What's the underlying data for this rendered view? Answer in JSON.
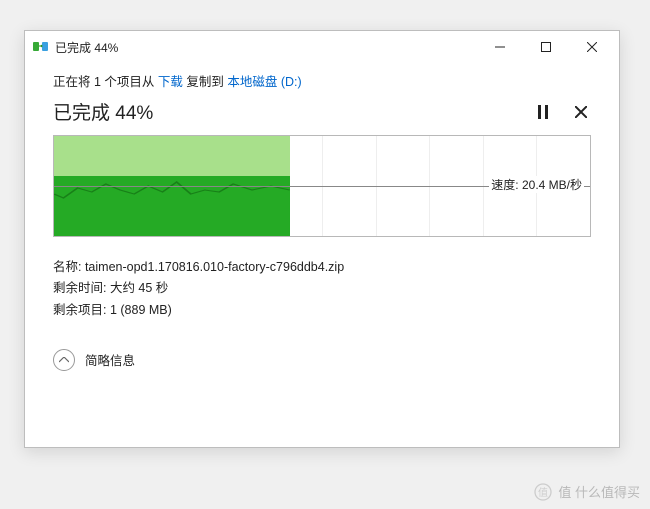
{
  "titlebar": {
    "title": "已完成 44%"
  },
  "copy_line": {
    "prefix": "正在将 1 个项目从 ",
    "source": "下载",
    "mid": " 复制到 ",
    "dest": "本地磁盘 (D:)"
  },
  "progress": {
    "label": "已完成 44%",
    "percent": 44
  },
  "speed": {
    "label": "速度: ",
    "value": "20.4 MB/秒"
  },
  "details": {
    "name_label": "名称: ",
    "name_value": "taimen-opd1.170816.010-factory-c796ddb4.zip",
    "time_label": "剩余时间: ",
    "time_value": "大约 45 秒",
    "items_label": "剩余项目: ",
    "items_value": "1 (889 MB)"
  },
  "expand": {
    "label": "简略信息"
  },
  "watermark": {
    "text": "值 什么值得买"
  },
  "chart_data": {
    "type": "area",
    "x_range": [
      0,
      100
    ],
    "progress_fill_pct": 44,
    "baseline_y": 50,
    "series": [
      {
        "name": "transfer-speed",
        "values": [
          52,
          48,
          58,
          55,
          62,
          57,
          52,
          60,
          55,
          63,
          52,
          57,
          55,
          62,
          57
        ]
      }
    ],
    "ylabel": "速度",
    "current_speed": "20.4 MB/秒"
  }
}
